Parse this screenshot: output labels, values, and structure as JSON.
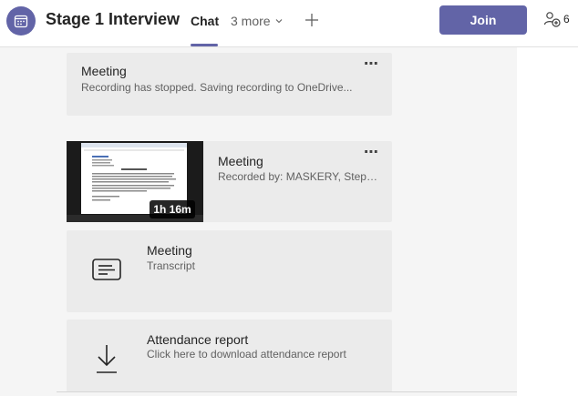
{
  "header": {
    "title": "Stage 1 Interview",
    "tab_chat": "Chat",
    "more_tabs": "3 more",
    "join_label": "Join",
    "participant_count": "6",
    "accent": "#6264a7"
  },
  "messages": [
    {
      "title": "Meeting",
      "subtitle": "Recording has stopped. Saving recording to OneDrive...",
      "more": "⋯"
    },
    {
      "title": "Meeting",
      "subtitle": "Recorded by: MASKERY, Stepha...",
      "duration": "1h 16m",
      "more": "⋯"
    },
    {
      "title": "Meeting",
      "subtitle": "Transcript",
      "icon": "transcript-icon"
    },
    {
      "title": "Attendance report",
      "subtitle": "Click here to download attendance report",
      "icon": "download-icon"
    }
  ]
}
